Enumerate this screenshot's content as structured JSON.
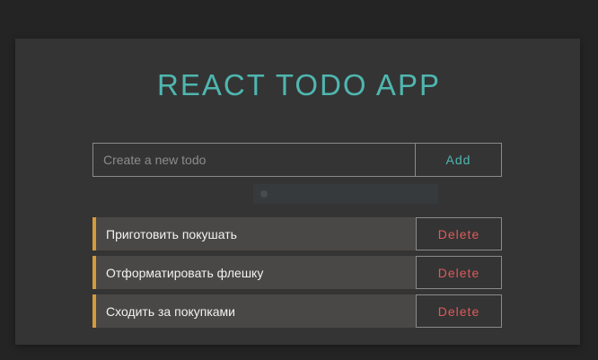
{
  "app": {
    "title": "REACT TODO APP"
  },
  "form": {
    "input_value": "",
    "input_placeholder": "Create a new todo",
    "add_label": "Add"
  },
  "todos": [
    {
      "text": "Приготовить покушать",
      "delete_label": "Delete"
    },
    {
      "text": "Отформатировать флешку",
      "delete_label": "Delete"
    },
    {
      "text": "Сходить за покупками",
      "delete_label": "Delete"
    }
  ],
  "colors": {
    "background": "#242424",
    "card": "#343434",
    "accent_teal": "#4fb6b0",
    "todo_border": "#d59a3c",
    "delete_red": "#e05a5a",
    "todo_bg": "#4a4846"
  }
}
